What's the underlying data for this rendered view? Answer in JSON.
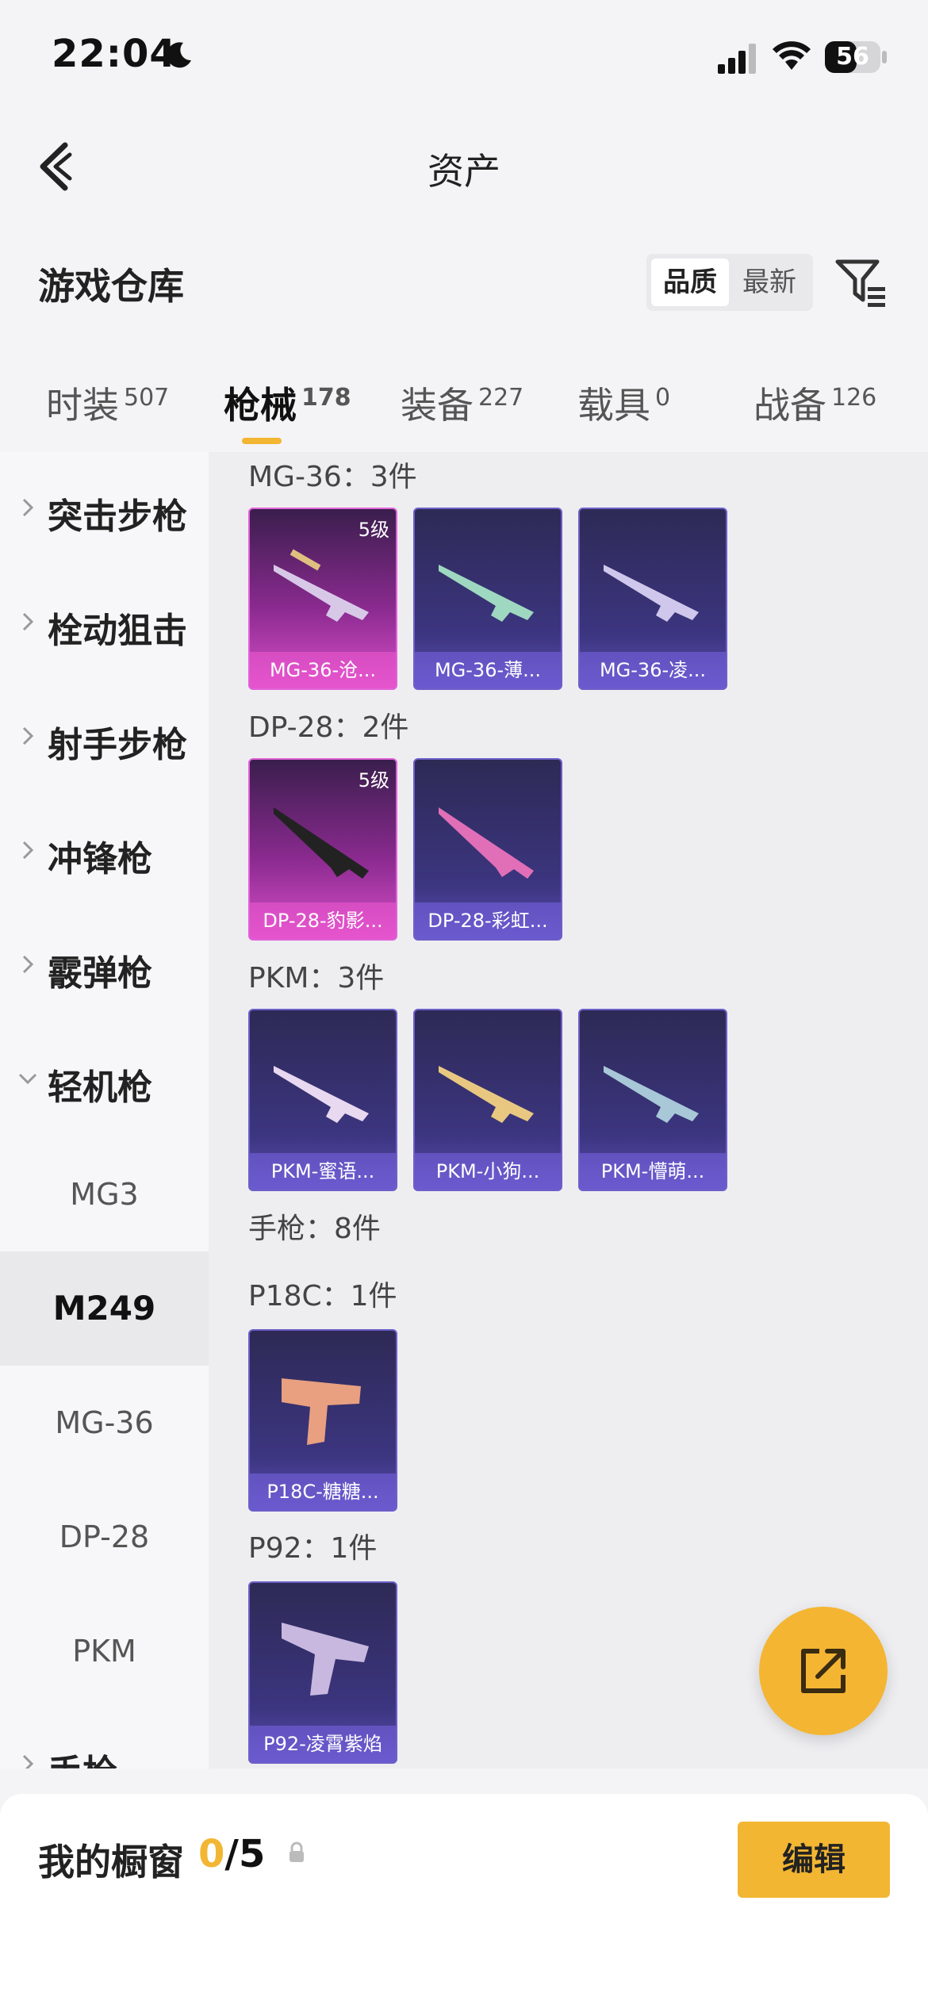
{
  "status_bar": {
    "time": "22:04",
    "battery": "56"
  },
  "nav": {
    "title": "资产"
  },
  "section": {
    "title": "游戏仓库",
    "sort_options": [
      "品质",
      "最新"
    ]
  },
  "tabs": [
    {
      "label": "时装",
      "count": "507"
    },
    {
      "label": "枪械",
      "count": "178"
    },
    {
      "label": "装备",
      "count": "227"
    },
    {
      "label": "载具",
      "count": "0"
    },
    {
      "label": "战备",
      "count": "126"
    }
  ],
  "sidebar": {
    "categories": [
      "突击步枪",
      "栓动狙击",
      "射手步枪",
      "冲锋枪",
      "霰弹枪",
      "轻机枪"
    ],
    "subs": [
      "MG3",
      "M249",
      "MG-36",
      "DP-28",
      "PKM"
    ],
    "last": "手枪"
  },
  "content": {
    "groups": [
      {
        "title": "MG-36：3件",
        "items": [
          {
            "name": "MG-36-沧...",
            "level": "5级"
          },
          {
            "name": "MG-36-薄..."
          },
          {
            "name": "MG-36-凌..."
          }
        ]
      },
      {
        "title": "DP-28：2件",
        "items": [
          {
            "name": "DP-28-豹影...",
            "level": "5级"
          },
          {
            "name": "DP-28-彩虹..."
          }
        ]
      },
      {
        "title": "PKM：3件",
        "items": [
          {
            "name": "PKM-蜜语..."
          },
          {
            "name": "PKM-小狗..."
          },
          {
            "name": "PKM-懵萌..."
          }
        ]
      },
      {
        "title": "手枪：8件"
      },
      {
        "title": "P18C：1件",
        "items": [
          {
            "name": "P18C-糖糖..."
          }
        ]
      },
      {
        "title": "P92：1件",
        "items": [
          {
            "name": "P92-凌霄紫焰"
          }
        ]
      }
    ]
  },
  "bottom": {
    "title": "我的橱窗",
    "current": "0",
    "total": "/5",
    "edit": "编辑"
  },
  "colors": {
    "accent": "#f2b633",
    "card_purple": "#3c3580",
    "card_pink": "#d94fc9"
  }
}
